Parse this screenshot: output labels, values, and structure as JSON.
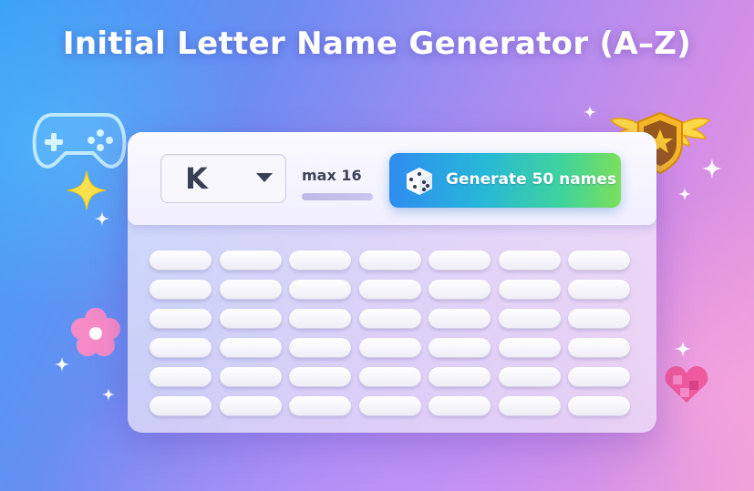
{
  "page": {
    "title": "Initial Letter Name Generator (A–Z)"
  },
  "toolbar": {
    "selected_letter": "K",
    "max_length_label": "max 16",
    "generate_button_label": "Generate 50 names"
  },
  "results": {
    "rows": 6,
    "columns": 7,
    "placeholder_count": 42
  },
  "icons": {
    "select_caret": "chevron-down-icon",
    "generate": "dice-icon",
    "decorations": [
      "gamepad-icon",
      "sparkle-icon",
      "star-badge-icon",
      "flower-icon",
      "heart-icon"
    ]
  },
  "colors": {
    "button_gradient_start": "#2f8cf0",
    "button_gradient_end": "#7be05a",
    "text_dark": "#3a3f55"
  }
}
